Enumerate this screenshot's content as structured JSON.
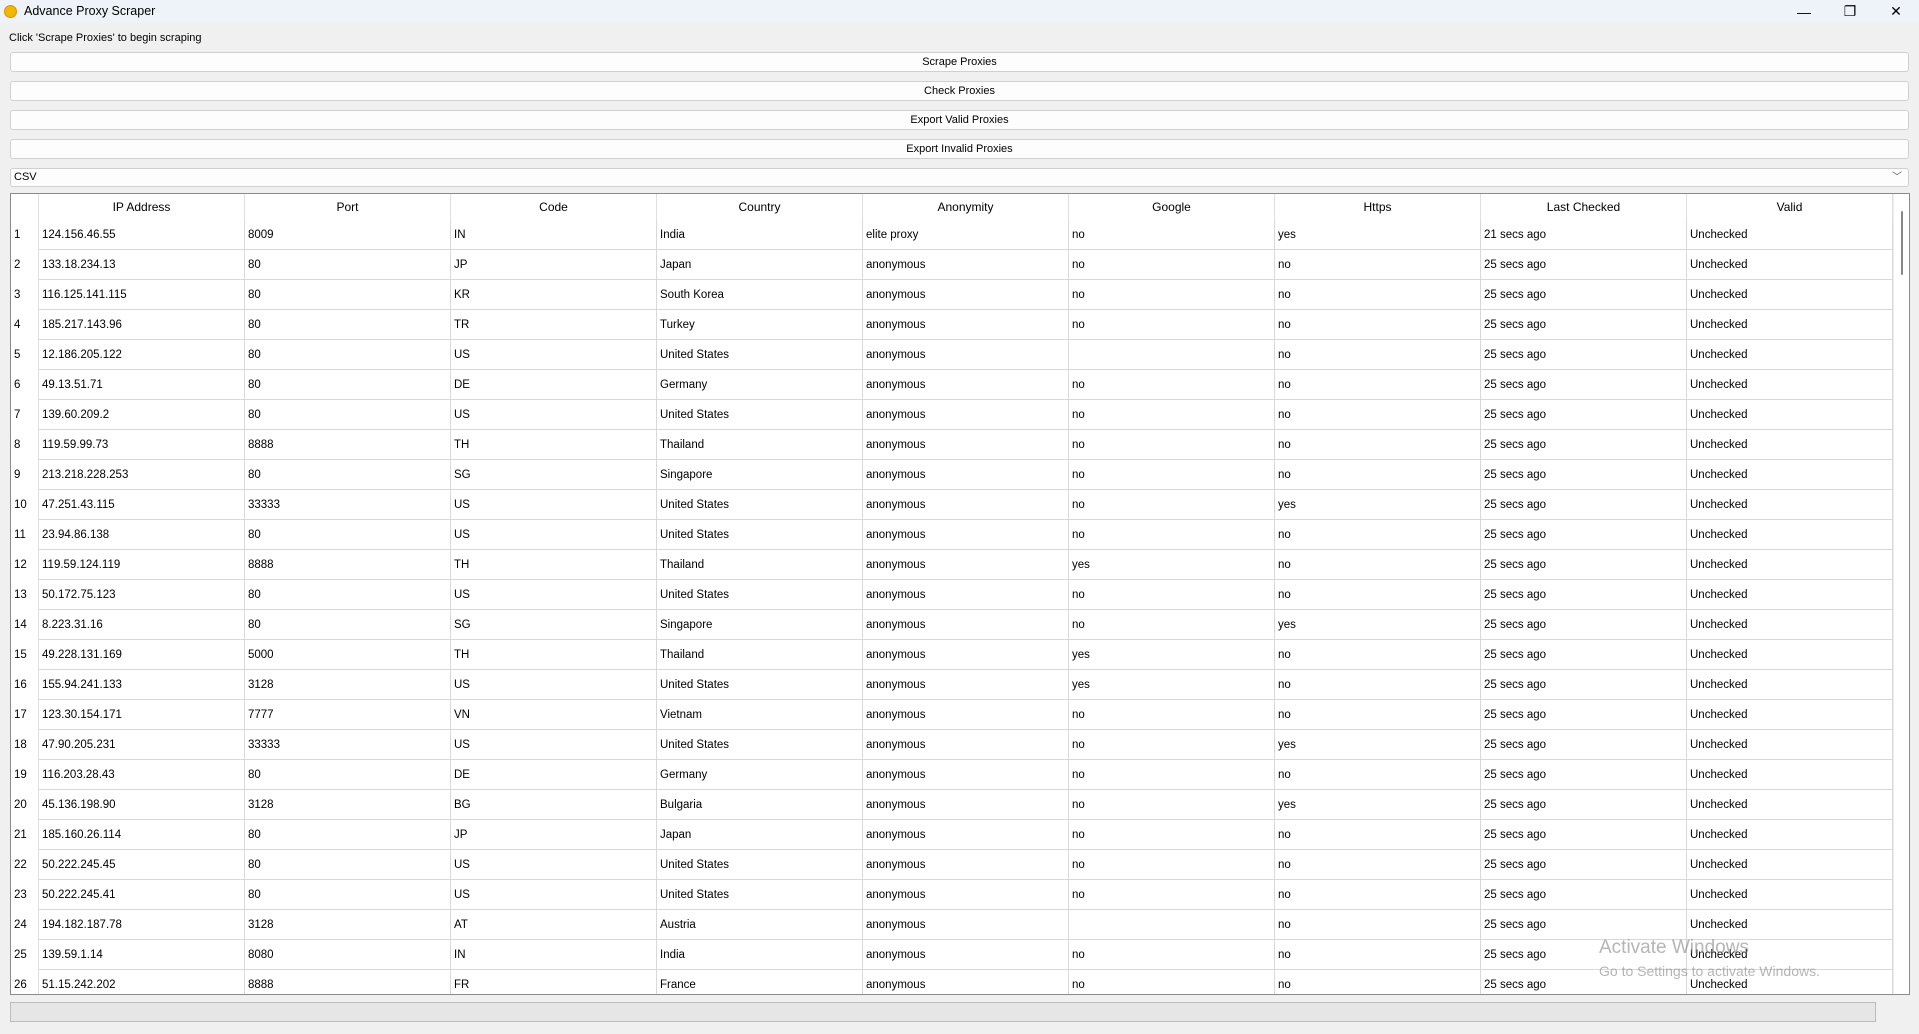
{
  "window": {
    "title": "Advance Proxy Scraper",
    "controls": {
      "minimize": "—",
      "maximize": "❐",
      "close": "✕"
    }
  },
  "status_text": "Click 'Scrape Proxies' to begin scraping",
  "buttons": {
    "scrape": "Scrape Proxies",
    "check": "Check Proxies",
    "export_valid": "Export Valid Proxies",
    "export_invalid": "Export Invalid Proxies"
  },
  "format_select": {
    "value": "CSV"
  },
  "table": {
    "columns": [
      "IP Address",
      "Port",
      "Code",
      "Country",
      "Anonymity",
      "Google",
      "Https",
      "Last Checked",
      "Valid"
    ],
    "rows": [
      [
        "124.156.46.55",
        "8009",
        "IN",
        "India",
        "elite proxy",
        "no",
        "yes",
        "21 secs ago",
        "Unchecked"
      ],
      [
        "133.18.234.13",
        "80",
        "JP",
        "Japan",
        "anonymous",
        "no",
        "no",
        "25 secs ago",
        "Unchecked"
      ],
      [
        "116.125.141.115",
        "80",
        "KR",
        "South Korea",
        "anonymous",
        "no",
        "no",
        "25 secs ago",
        "Unchecked"
      ],
      [
        "185.217.143.96",
        "80",
        "TR",
        "Turkey",
        "anonymous",
        "no",
        "no",
        "25 secs ago",
        "Unchecked"
      ],
      [
        "12.186.205.122",
        "80",
        "US",
        "United States",
        "anonymous",
        "",
        "no",
        "25 secs ago",
        "Unchecked"
      ],
      [
        "49.13.51.71",
        "80",
        "DE",
        "Germany",
        "anonymous",
        "no",
        "no",
        "25 secs ago",
        "Unchecked"
      ],
      [
        "139.60.209.2",
        "80",
        "US",
        "United States",
        "anonymous",
        "no",
        "no",
        "25 secs ago",
        "Unchecked"
      ],
      [
        "119.59.99.73",
        "8888",
        "TH",
        "Thailand",
        "anonymous",
        "no",
        "no",
        "25 secs ago",
        "Unchecked"
      ],
      [
        "213.218.228.253",
        "80",
        "SG",
        "Singapore",
        "anonymous",
        "no",
        "no",
        "25 secs ago",
        "Unchecked"
      ],
      [
        "47.251.43.115",
        "33333",
        "US",
        "United States",
        "anonymous",
        "no",
        "yes",
        "25 secs ago",
        "Unchecked"
      ],
      [
        "23.94.86.138",
        "80",
        "US",
        "United States",
        "anonymous",
        "no",
        "no",
        "25 secs ago",
        "Unchecked"
      ],
      [
        "119.59.124.119",
        "8888",
        "TH",
        "Thailand",
        "anonymous",
        "yes",
        "no",
        "25 secs ago",
        "Unchecked"
      ],
      [
        "50.172.75.123",
        "80",
        "US",
        "United States",
        "anonymous",
        "no",
        "no",
        "25 secs ago",
        "Unchecked"
      ],
      [
        "8.223.31.16",
        "80",
        "SG",
        "Singapore",
        "anonymous",
        "no",
        "yes",
        "25 secs ago",
        "Unchecked"
      ],
      [
        "49.228.131.169",
        "5000",
        "TH",
        "Thailand",
        "anonymous",
        "yes",
        "no",
        "25 secs ago",
        "Unchecked"
      ],
      [
        "155.94.241.133",
        "3128",
        "US",
        "United States",
        "anonymous",
        "yes",
        "no",
        "25 secs ago",
        "Unchecked"
      ],
      [
        "123.30.154.171",
        "7777",
        "VN",
        "Vietnam",
        "anonymous",
        "no",
        "no",
        "25 secs ago",
        "Unchecked"
      ],
      [
        "47.90.205.231",
        "33333",
        "US",
        "United States",
        "anonymous",
        "no",
        "yes",
        "25 secs ago",
        "Unchecked"
      ],
      [
        "116.203.28.43",
        "80",
        "DE",
        "Germany",
        "anonymous",
        "no",
        "no",
        "25 secs ago",
        "Unchecked"
      ],
      [
        "45.136.198.90",
        "3128",
        "BG",
        "Bulgaria",
        "anonymous",
        "no",
        "yes",
        "25 secs ago",
        "Unchecked"
      ],
      [
        "185.160.26.114",
        "80",
        "JP",
        "Japan",
        "anonymous",
        "no",
        "no",
        "25 secs ago",
        "Unchecked"
      ],
      [
        "50.222.245.45",
        "80",
        "US",
        "United States",
        "anonymous",
        "no",
        "no",
        "25 secs ago",
        "Unchecked"
      ],
      [
        "50.222.245.41",
        "80",
        "US",
        "United States",
        "anonymous",
        "no",
        "no",
        "25 secs ago",
        "Unchecked"
      ],
      [
        "194.182.187.78",
        "3128",
        "AT",
        "Austria",
        "anonymous",
        "",
        "no",
        "25 secs ago",
        "Unchecked"
      ],
      [
        "139.59.1.14",
        "8080",
        "IN",
        "India",
        "anonymous",
        "no",
        "no",
        "25 secs ago",
        "Unchecked"
      ],
      [
        "51.15.242.202",
        "8888",
        "FR",
        "France",
        "anonymous",
        "no",
        "no",
        "25 secs ago",
        "Unchecked"
      ]
    ]
  },
  "progress": {
    "value": 0
  },
  "watermark": {
    "line1": "Activate Windows",
    "line2": "Go to Settings to activate Windows."
  }
}
